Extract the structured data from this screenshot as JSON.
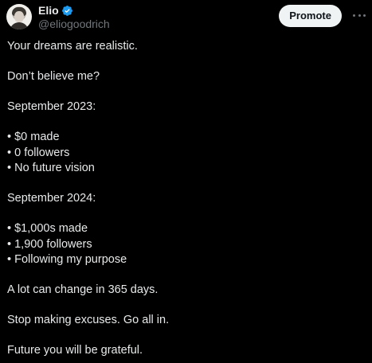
{
  "author": {
    "display_name": "Elio",
    "handle": "@eliogoodrich",
    "verified": true
  },
  "actions": {
    "promote_label": "Promote"
  },
  "icons": {
    "verified": "verified-badge-icon",
    "more": "more-horizontal-icon"
  },
  "colors": {
    "background": "#000000",
    "text": "#e7e9ea",
    "secondary_text": "#71767b",
    "verified_blue": "#1d9bf0",
    "button_bg": "#eff3f4"
  },
  "tweet": {
    "intro": "Your dreams are realistic.",
    "question": "Don’t believe me?",
    "before_heading": "September 2023:",
    "before_items": [
      "• $0 made",
      "• 0 followers",
      "• No future vision"
    ],
    "after_heading": "September 2024:",
    "after_items": [
      "• $1,000s made",
      "• 1,900 followers",
      "• Following my purpose"
    ],
    "change_line": "A lot can change in 365 days.",
    "cta_line": "Stop making excuses. Go all in.",
    "closing_line": "Future you will be grateful."
  }
}
